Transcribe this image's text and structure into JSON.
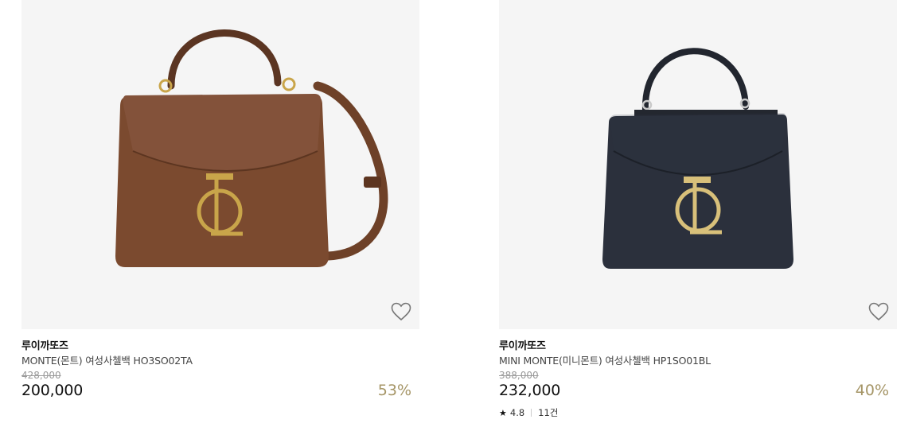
{
  "products": [
    {
      "brand": "루이까또즈",
      "name": "MONTE(몬트) 여성사첼백 HO3SO02TA",
      "original_price": "428,000",
      "price": "200,000",
      "discount": "53%",
      "bag_color": "#7a4a30",
      "wishlist_icon": "heart-outline-icon"
    },
    {
      "brand": "루이까또즈",
      "name": "MINI MONTE(미니몬트) 여성사첼백 HP1SO01BL",
      "original_price": "388,000",
      "price": "232,000",
      "discount": "40%",
      "rating": "4.8",
      "review_count": "11건",
      "bag_color": "#2a2f3d",
      "wishlist_icon": "heart-outline-icon"
    }
  ],
  "colors": {
    "discount": "#a59566",
    "thumb_bg": "#f5f5f5"
  }
}
